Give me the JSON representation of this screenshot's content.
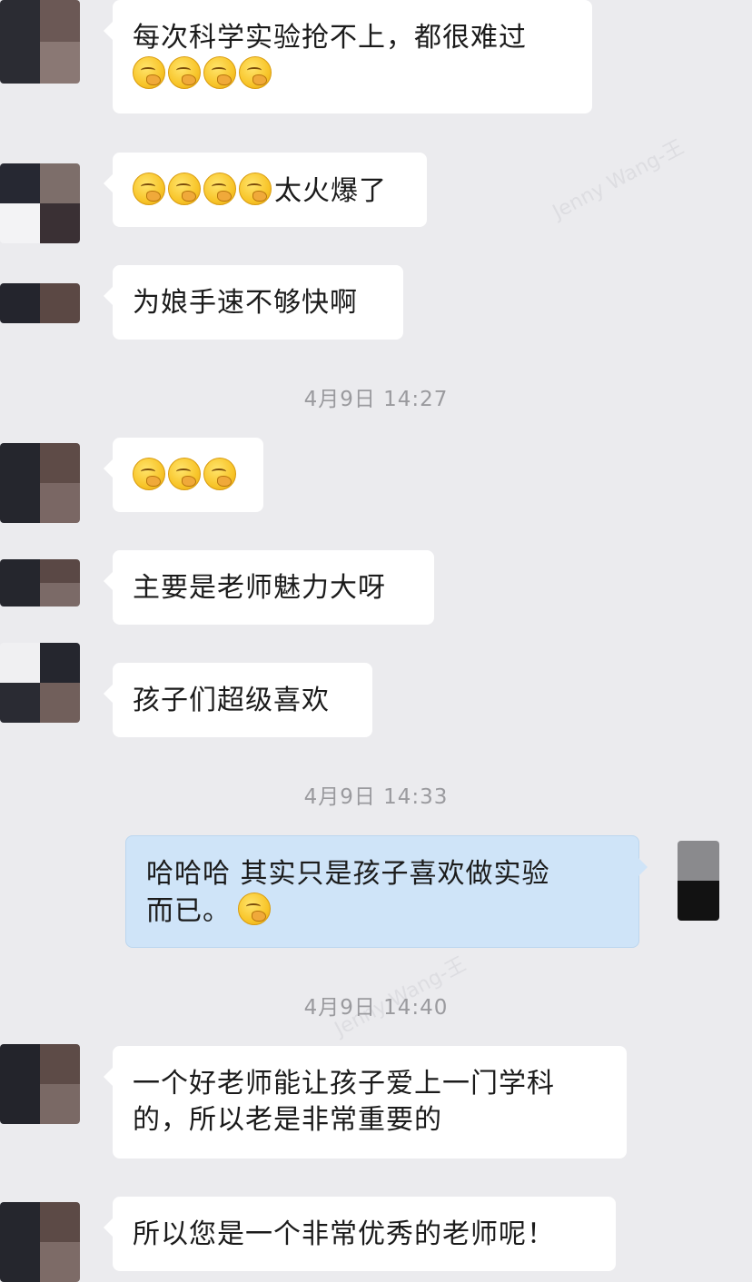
{
  "messages": [
    {
      "text": "每次科学实验抢不上，都很难过",
      "emoji_count": 4
    },
    {
      "text": "太火爆了",
      "emoji_count": 4
    },
    {
      "text": "为娘手速不够快啊"
    },
    {
      "time": "4月9日 14:27"
    },
    {
      "emoji_count": 3
    },
    {
      "text": "主要是老师魅力大呀"
    },
    {
      "text": "孩子们超级喜欢"
    },
    {
      "time": "4月9日 14:33"
    },
    {
      "text": "哈哈哈 其实只是孩子喜欢做实验\n而已。",
      "emoji_count": 1
    },
    {
      "time": "4月9日 14:40"
    },
    {
      "text": "一个好老师能让孩子爱上一门学科\n的，所以老是非常重要的"
    },
    {
      "text": "所以您是一个非常优秀的老师呢！"
    }
  ],
  "watermark": "Jenny Wang-王"
}
